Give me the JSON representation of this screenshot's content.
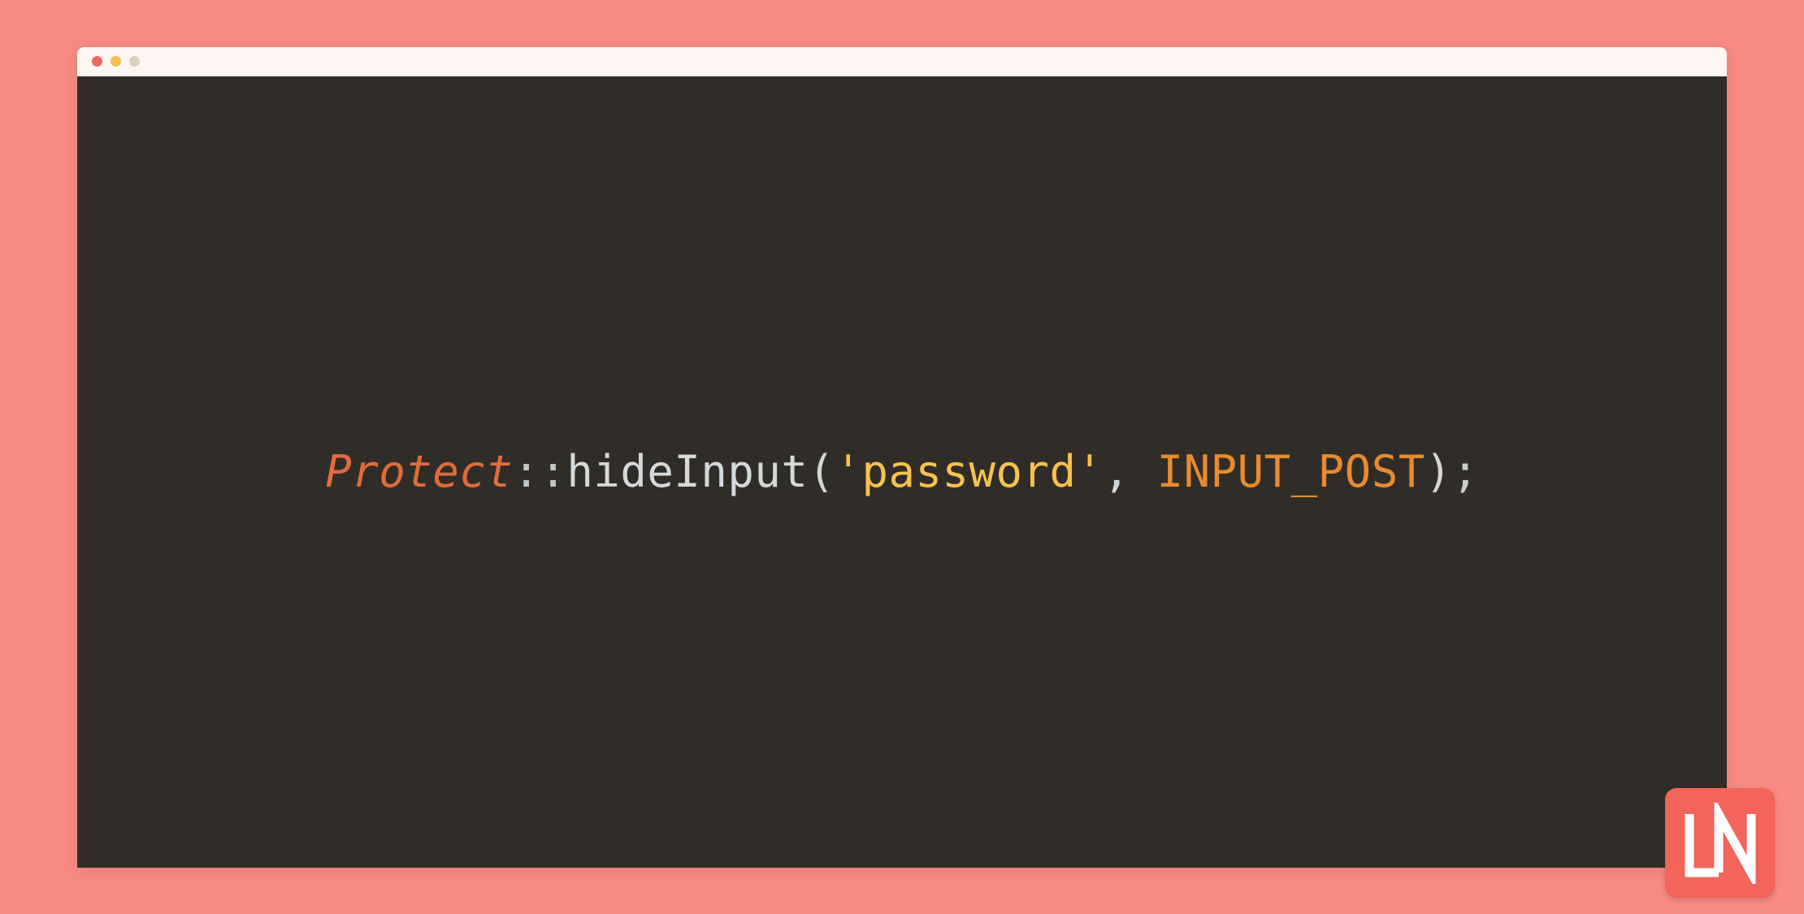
{
  "colors": {
    "background": "#f98b84",
    "editor_bg": "#302d29",
    "titlebar_bg": "#fdf6f2",
    "dot_red": "#ed6a5e",
    "dot_yellow": "#f5bf4f",
    "dot_green": "#d9d0c2",
    "logo_bg": "#f3645a"
  },
  "code": {
    "class_name": "Protect",
    "scope_op": "::",
    "fn_name": "hideInput",
    "paren_open": "(",
    "string_arg": "'password'",
    "comma_sp": ", ",
    "const_arg": "INPUT_POST",
    "paren_close": ")",
    "semi": ";"
  },
  "logo": {
    "text": "LN"
  }
}
